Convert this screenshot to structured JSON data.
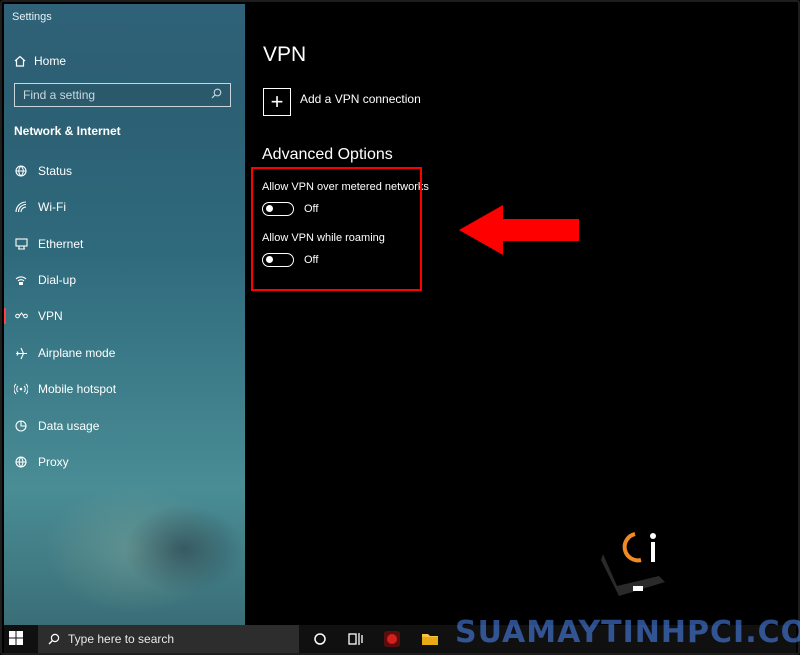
{
  "window": {
    "title": "Settings"
  },
  "sidebar": {
    "home_label": "Home",
    "search_placeholder": "Find a setting",
    "section_title": "Network & Internet",
    "items": [
      {
        "label": "Status",
        "icon": "globe-status-icon"
      },
      {
        "label": "Wi-Fi",
        "icon": "wifi-icon"
      },
      {
        "label": "Ethernet",
        "icon": "ethernet-icon"
      },
      {
        "label": "Dial-up",
        "icon": "dialup-icon"
      },
      {
        "label": "VPN",
        "icon": "vpn-icon",
        "selected": true
      },
      {
        "label": "Airplane mode",
        "icon": "airplane-icon"
      },
      {
        "label": "Mobile hotspot",
        "icon": "hotspot-icon"
      },
      {
        "label": "Data usage",
        "icon": "data-usage-icon"
      },
      {
        "label": "Proxy",
        "icon": "globe-icon"
      }
    ]
  },
  "main": {
    "page_title": "VPN",
    "add_vpn_label": "Add a VPN connection",
    "advanced_title": "Advanced Options",
    "options": [
      {
        "label": "Allow VPN over metered networks",
        "state": "Off"
      },
      {
        "label": "Allow VPN while roaming",
        "state": "Off"
      }
    ]
  },
  "taskbar": {
    "search_placeholder": "Type here to search"
  },
  "watermark": "SUAMAYTINHPCI.COM",
  "colors": {
    "highlight": "#ff0000",
    "selected_bar": "#ff4444",
    "accent": "#f08a24"
  }
}
